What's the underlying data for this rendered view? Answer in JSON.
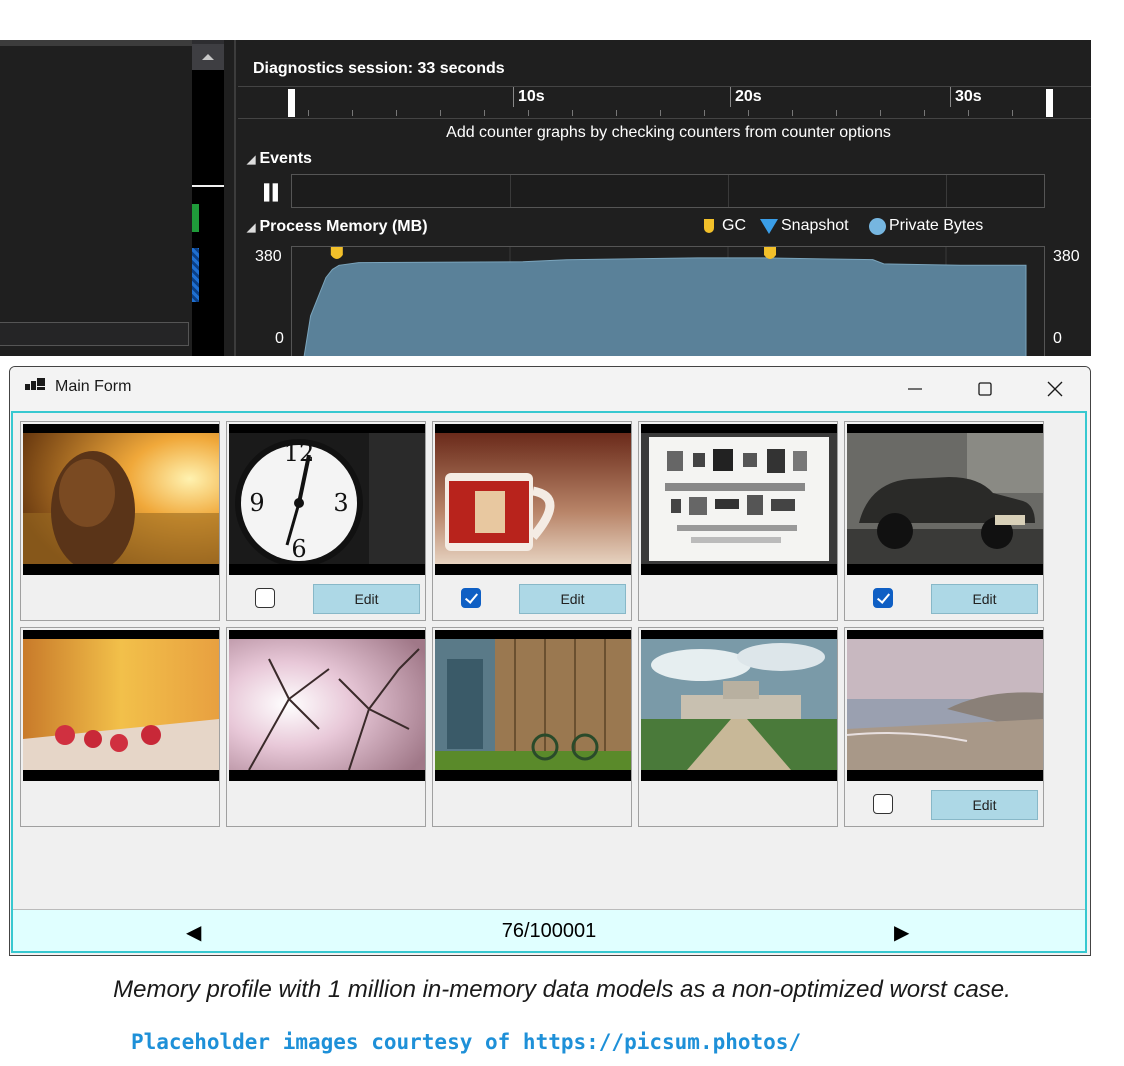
{
  "diagnostics": {
    "session_title": "Diagnostics session: 33 seconds",
    "ruler_ticks": [
      "10s",
      "20s",
      "30s"
    ],
    "hint": "Add counter graphs by checking counters from counter options",
    "events_header": "Events",
    "events_pause_icon": "pause-icon",
    "memory_header": "Process Memory (MB)",
    "legend": {
      "gc": "GC",
      "snapshot": "Snapshot",
      "private_bytes": "Private Bytes"
    },
    "legend_colors": {
      "gc": "#f2c02a",
      "snapshot": "#3a9ee8",
      "private_bytes": "#76b6e0"
    },
    "y_max_label": "380",
    "y_min_label": "0",
    "area_color": "#5a8199"
  },
  "chart_data": {
    "type": "area",
    "ylim": [
      0,
      380
    ],
    "xlim": [
      0,
      33
    ],
    "series": [
      {
        "name": "Private Bytes",
        "x": [
          0,
          0.3,
          1.0,
          1.3,
          1.6,
          2.5,
          10,
          12,
          18,
          21,
          24,
          26,
          26.5,
          30,
          33
        ],
        "values": [
          0,
          150,
          290,
          320,
          335,
          345,
          348,
          355,
          362,
          362,
          358,
          356,
          340,
          335,
          335
        ]
      }
    ],
    "gc_events_s": [
      1.5,
      21.3
    ],
    "snapshot_events_s": []
  },
  "window": {
    "title": "Main Form",
    "minimize_icon": "minimize-icon",
    "maximize_icon": "maximize-icon",
    "close_icon": "close-icon"
  },
  "grid": {
    "cards": [
      {
        "subject": "girl in golden field",
        "checkbox": null,
        "edit_label": ""
      },
      {
        "subject": "clock face",
        "checkbox": false,
        "edit_label": "Edit"
      },
      {
        "subject": "red mug",
        "checkbox": true,
        "edit_label": "Edit"
      },
      {
        "subject": "flat-lay of parts",
        "checkbox": null,
        "edit_label": ""
      },
      {
        "subject": "vintage car",
        "checkbox": true,
        "edit_label": "Edit"
      },
      {
        "subject": "raspberries",
        "checkbox": null,
        "edit_label": ""
      },
      {
        "subject": "tree branches against sky",
        "checkbox": null,
        "edit_label": ""
      },
      {
        "subject": "wooden shed with bicycle",
        "checkbox": null,
        "edit_label": ""
      },
      {
        "subject": "chateau and path",
        "checkbox": null,
        "edit_label": ""
      },
      {
        "subject": "misty beach",
        "checkbox": false,
        "edit_label": "Edit"
      }
    ]
  },
  "pager": {
    "prev_icon": "prev-arrow-icon",
    "next_icon": "next-arrow-icon",
    "position_text": "76/100001"
  },
  "caption": "Memory profile with 1 million in-memory data models as a non-optimized worst case.",
  "credit": "Placeholder images courtesy of https://picsum.photos/"
}
